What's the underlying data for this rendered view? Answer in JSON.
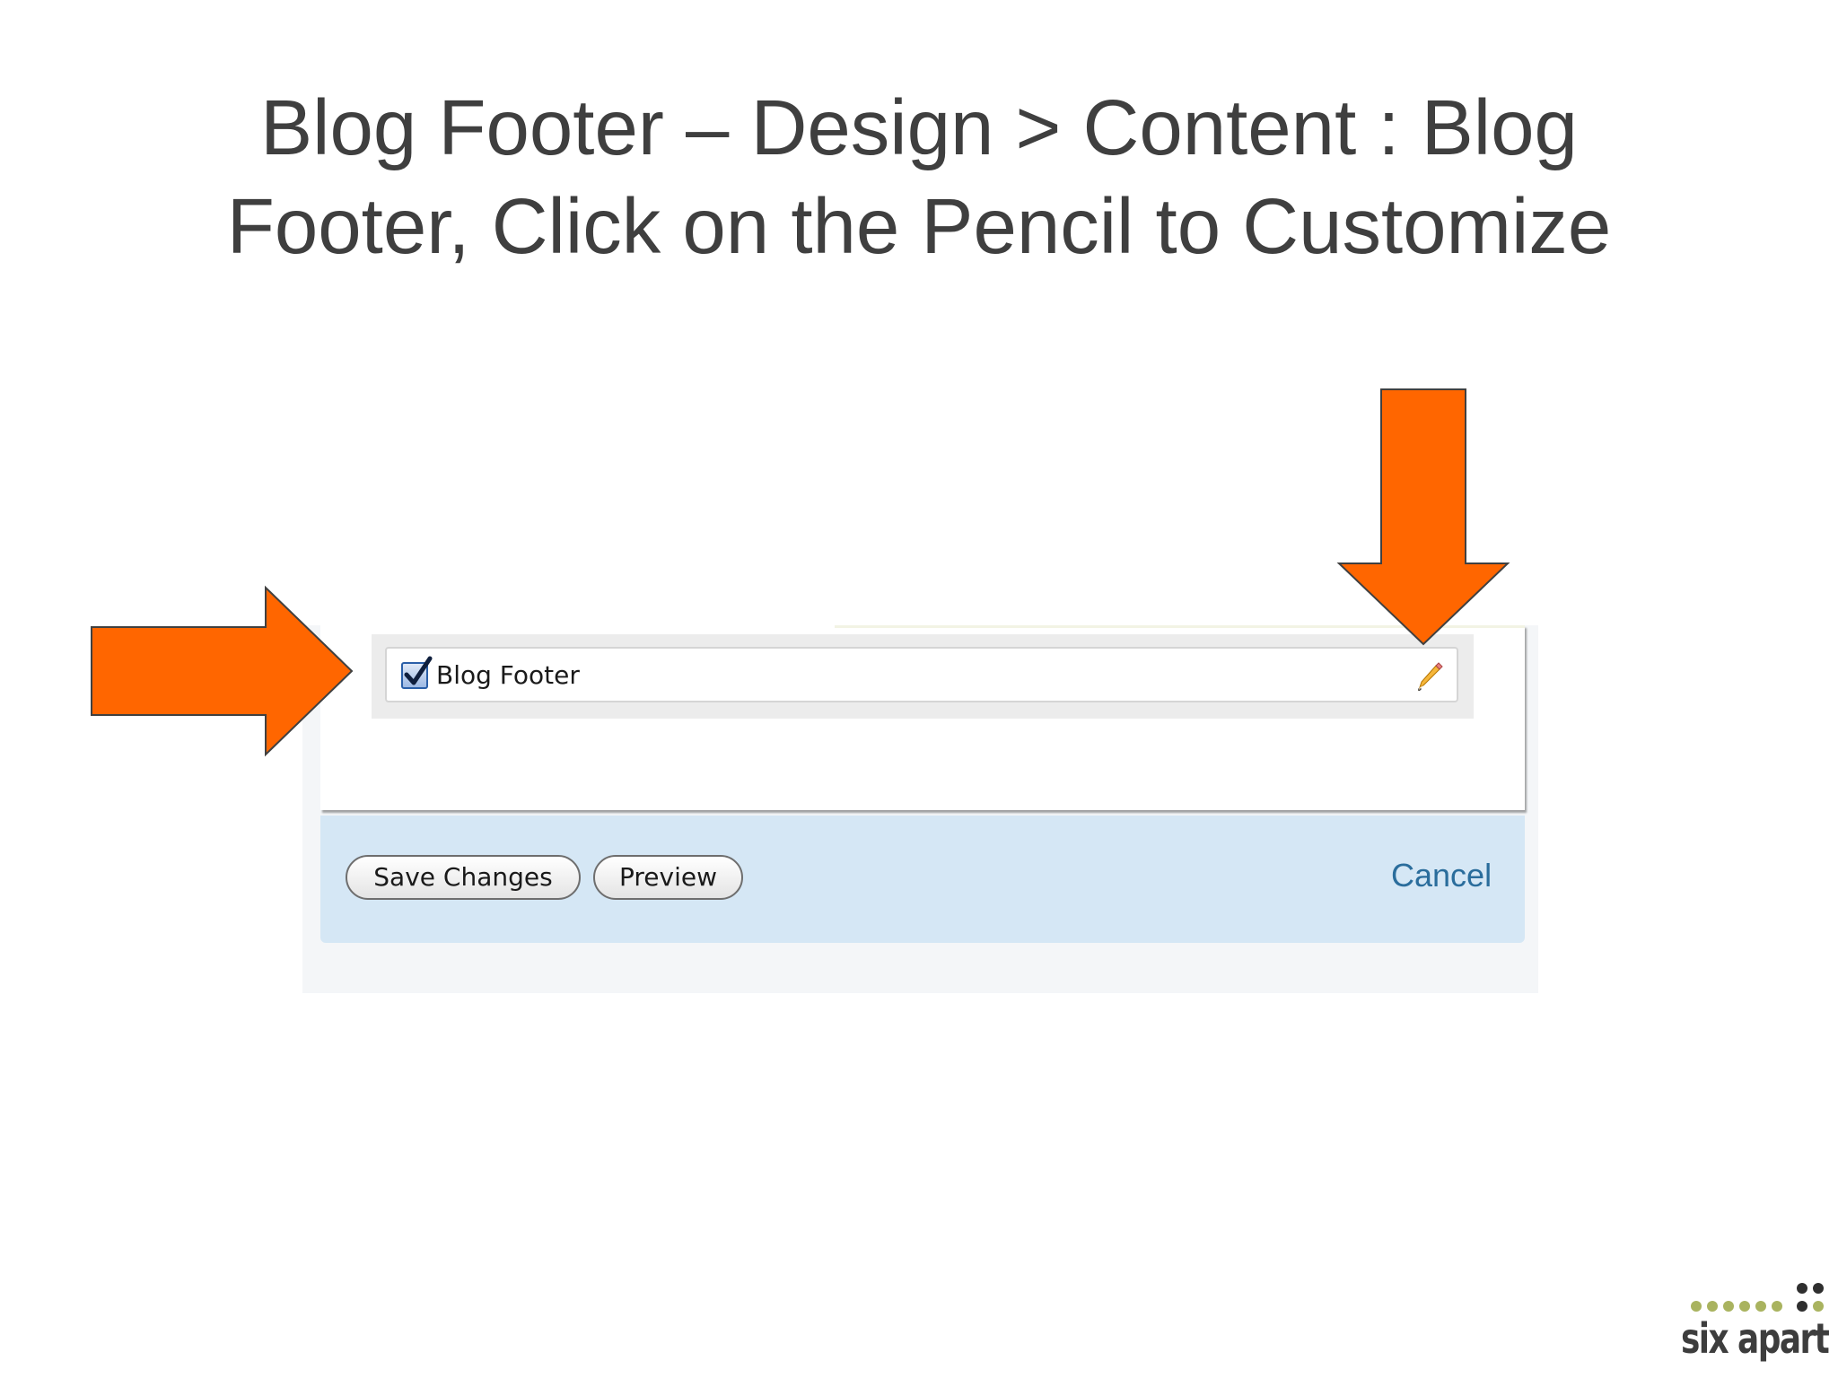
{
  "slide": {
    "title_line1": "Blog Footer – Design > Content : Blog",
    "title_line2": "Footer, Click on the Pencil to Customize"
  },
  "widget": {
    "label": "Blog Footer",
    "checked": true,
    "edit_icon": "pencil-icon"
  },
  "actions": {
    "save_label": "Save Changes",
    "preview_label": "Preview",
    "cancel_label": "Cancel"
  },
  "annotations": {
    "arrow_color": "#ff6600",
    "arrows": [
      "right-arrow",
      "down-arrow"
    ]
  },
  "brand": {
    "name": "six apart"
  },
  "colors": {
    "title_text": "#3f3f3f",
    "action_bar": "#d5e7f5",
    "cancel_link": "#2a6d9c"
  }
}
